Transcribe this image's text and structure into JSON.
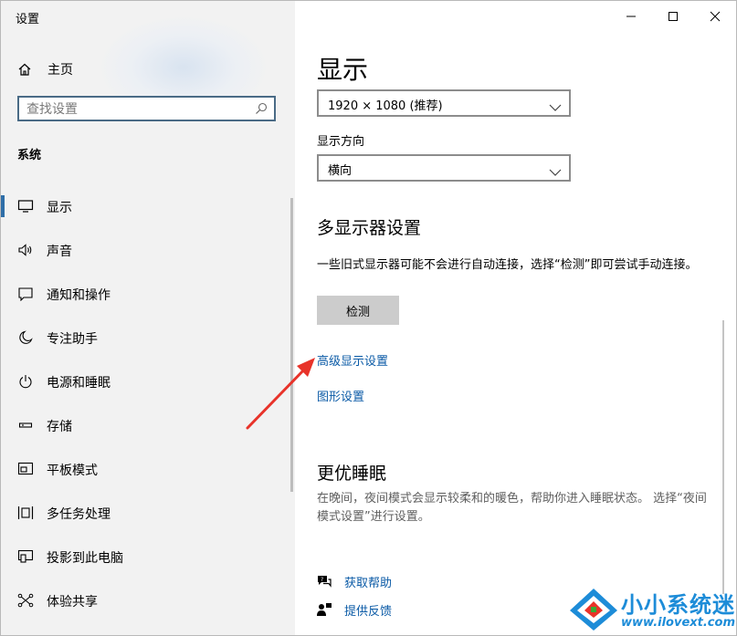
{
  "window": {
    "title": "设置"
  },
  "sidebar": {
    "home_label": "主页",
    "search_placeholder": "查找设置",
    "section_title": "系统",
    "items": [
      {
        "label": "显示",
        "icon": "monitor-icon",
        "active": true
      },
      {
        "label": "声音",
        "icon": "speaker-icon"
      },
      {
        "label": "通知和操作",
        "icon": "notification-icon"
      },
      {
        "label": "专注助手",
        "icon": "moon-icon"
      },
      {
        "label": "电源和睡眠",
        "icon": "power-icon"
      },
      {
        "label": "存储",
        "icon": "storage-icon"
      },
      {
        "label": "平板模式",
        "icon": "tablet-icon"
      },
      {
        "label": "多任务处理",
        "icon": "multitask-icon"
      },
      {
        "label": "投影到此电脑",
        "icon": "project-icon"
      },
      {
        "label": "体验共享",
        "icon": "share-icon"
      }
    ]
  },
  "main": {
    "title": "显示",
    "resolution_value": "1920 × 1080 (推荐)",
    "orientation_label": "显示方向",
    "orientation_value": "横向",
    "multi_display_heading": "多显示器设置",
    "multi_display_desc": "一些旧式显示器可能不会进行自动连接，选择“检测”即可尝试手动连接。",
    "detect_button": "检测",
    "advanced_link": "高级显示设置",
    "graphics_link": "图形设置",
    "sleep_heading": "更优睡眠",
    "sleep_desc": "在晚间，夜间模式会显示较柔和的暖色，帮助你进入睡眠状态。 选择“夜间模式设置”进行设置。",
    "help_label": "获取帮助",
    "feedback_label": "提供反馈"
  },
  "watermark": {
    "name": "小小系统迷",
    "url": "www.ilovext.com"
  },
  "colors": {
    "accent": "#2e6ea8",
    "link": "#0a5aa6",
    "annotation_arrow": "#e8332a",
    "watermark": "#1d8cd8"
  }
}
